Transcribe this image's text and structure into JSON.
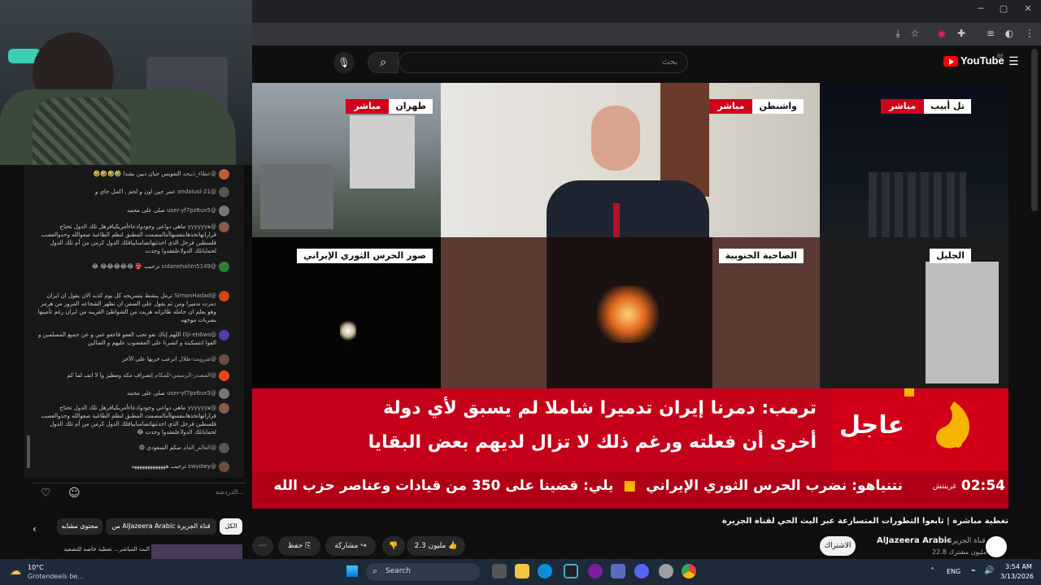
{
  "youtube": {
    "logo": "YouTube",
    "region": "BE",
    "search_placeholder": "بحث"
  },
  "tiles": [
    {
      "city": "طهران",
      "status": "مباشر"
    },
    {
      "city": "واشنطن",
      "status": "مباشر"
    },
    {
      "city": "تل أبيب",
      "status": "مباشر"
    },
    {
      "city": "صور الحرس الثوري الإيراني"
    },
    {
      "city": "الضاحية الجنوبية"
    },
    {
      "city": "الجليل"
    }
  ],
  "breaking": {
    "label": "عاجل",
    "line1": "ترمب: دمرنا إيران تدميرا شاملا لم يسبق لأي دولة",
    "line2": "أخرى أن فعلته ورغم ذلك لا تزال لديهم بعض البقايا",
    "crawl": "يلي: قضينا على 350 من قيادات وعناصر حزب الله",
    "crawl2": "نتنياهو: نضرب الحرس الثوري الإيراني",
    "time": "02:54",
    "time_label": "غرينتش"
  },
  "video": {
    "title": "تغطية مباشرة | تابعوا التطورات المتسارعة عبر البث الحي لقناة الجزيرة",
    "channel": "AlJazeera Arabic",
    "channel_sub": "قناة الجزيرة",
    "subscribers": "22.8 مليون مشترك",
    "subscribe": "الاشتراك",
    "likes": "2.3 مليون",
    "share": "مشاركة",
    "save": "حفظ"
  },
  "chat": {
    "messages": [
      {
        "author": "@عطاء_ذبيحه",
        "text": "التعويس جبان ديين بشدا 🤣🤣🤣🤣",
        "color": "#c05a3a"
      },
      {
        "author": "@andalusi-21",
        "text": "عمر جين اون و لحم , اكمل جاي و",
        "color": "#555"
      },
      {
        "author": "@user-yf7pz6ux5",
        "text": "صلى على محمد",
        "color": "#777"
      },
      {
        "author": "@ﻫyyyyyy",
        "text": "ماهي دواعي وجودوادعاءأمريكيافرهل تلك الدول تحتاج قراراتهاتخذهابنفسهاأمالمصمت المطبق لنظم الطاغية صعوالله وحدوالعصب فلسطين فرحل الذي احدثتهاتضامنابيافلك الدول كرمن من أم تلك الدول لحماياتلك الدولاعلفقدوا وجدت",
        "color": "#8a5a4a"
      },
      {
        "author": "@sidanehalim5149",
        "text": "ترحيب 👺 😂😂😂😂😂 😂",
        "color": "#2e7d32"
      },
      {
        "author": "@SimonHadad",
        "text": "ترمل ينشط بتسريحه كل يوم كذبه الان يقول ان ايران دمرت تدميرا ومن ثم يقول على السفن ان تظهر الشجاعه المرور من هرمز وهو يعلم ان حاملة طائراته هربت من الشواطئ القريبه من ايران رغم تأمينها بضربات موجهه",
        "color": "#d84315"
      },
      {
        "author": "@Dji-eb6ws",
        "text": "اللهم إناك نفو تحب العفو فاعفو عني و عن جميع المسلمين و الفوا انتسكينة و انصرنا على المغضوب عليهم و الضالين",
        "color": "#5e35b1"
      },
      {
        "author": "@شروبت-طلال",
        "text": "انزعب خربها على الآخر",
        "color": "#6d4c41"
      },
      {
        "author": "@المصدر-الرسمي-للمكام",
        "text": "إنصراف مكه ومطيز وا لا انف لما كم",
        "color": "#e64a19"
      },
      {
        "author": "@user-yf7pz6ux5",
        "text": "صلى على محمد",
        "color": "#777"
      },
      {
        "author": "@ﻫyyyyyy",
        "text": "ماهي دواعي وجودوادعاءأمريكيافرهل تلك الدول تحتاج قراراتهاتخذهابنفسهاأمالمصمت المطبق لنظم الطاغية صعوالله وحدوالعصب فلسطين فرحل الذي احدثتهاتضامنابيافلك الدول كرمن من أم تلك الدول لحماياتلك الدولاعلفقدوا وجدت 😂",
        "color": "#8a5a4a"
      },
      {
        "author": "@العالم_العام",
        "text": "صكم السعودي 😄",
        "color": "#555"
      },
      {
        "author": "@swydwy",
        "text": "ترحيب هههههههههههههه",
        "color": "#6d4c41"
      }
    ],
    "input_placeholder": "الدردشة...",
    "chips": [
      "الكل",
      "من AlJazeera Arabic قناة الجزيرة",
      "محتوى مشابه"
    ],
    "related_title": "البث المباشر... تغطية خاصة للتصعيد"
  },
  "browser": {
    "taskbar_search": "Search",
    "weather_temp": "10°C",
    "weather_desc": "Grotendeels be...",
    "lang": "ENG",
    "time": "3:54 AM",
    "date": "3/13/2026"
  },
  "colors": {
    "aj_red": "#c4001a",
    "yt_red": "#ff0000"
  }
}
